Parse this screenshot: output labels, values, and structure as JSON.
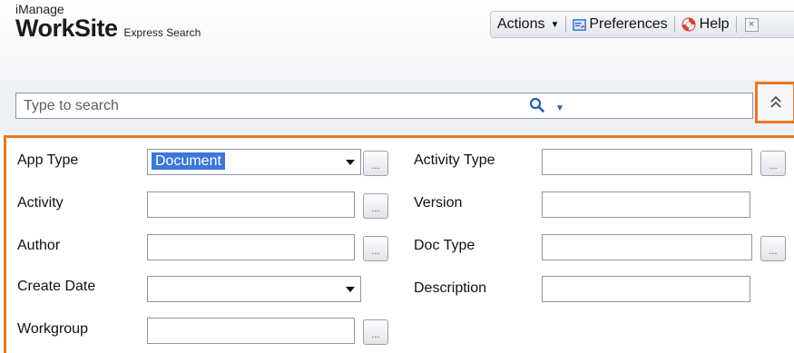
{
  "header": {
    "logo_top": "iManage",
    "logo_main": "WorkSite",
    "logo_sub": "Express Search",
    "toolbar": {
      "actions_label": "Actions",
      "preferences_label": "Preferences",
      "help_label": "Help",
      "close_label": "×"
    }
  },
  "search": {
    "placeholder": "Type to search"
  },
  "form": {
    "app_type_label": "App Type",
    "app_type_value": "Document",
    "activity_label": "Activity",
    "author_label": "Author",
    "create_date_label": "Create Date",
    "workgroup_label": "Workgroup",
    "activity_type_label": "Activity Type",
    "version_label": "Version",
    "doc_type_label": "Doc Type",
    "description_label": "Description",
    "browse_label": "..."
  },
  "colors": {
    "highlight_border": "#e87722",
    "selection": "#3b78d8",
    "search_accent": "#1f5fae"
  }
}
